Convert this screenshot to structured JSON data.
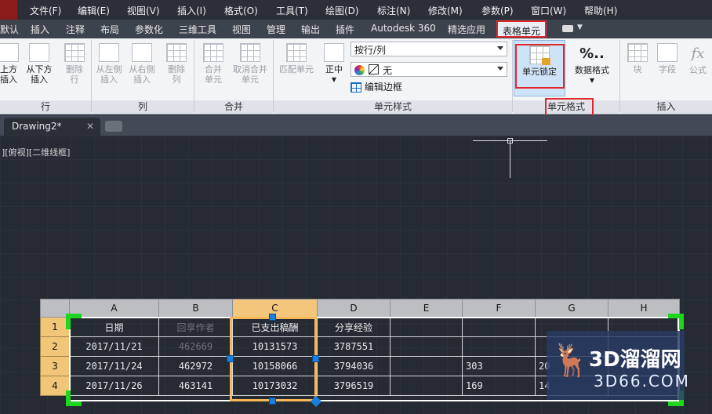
{
  "menu": {
    "items": [
      "文件(F)",
      "编辑(E)",
      "视图(V)",
      "插入(I)",
      "格式(O)",
      "工具(T)",
      "绘图(D)",
      "标注(N)",
      "修改(M)",
      "参数(P)",
      "窗口(W)",
      "帮助(H)"
    ]
  },
  "tabs": {
    "items": [
      "默认",
      "插入",
      "注释",
      "布局",
      "参数化",
      "三维工具",
      "视图",
      "管理",
      "输出",
      "插件",
      "Autodesk 360",
      "精选应用",
      "表格单元"
    ],
    "active": "表格单元"
  },
  "ribbon": {
    "rows": {
      "title": "行",
      "insert_above": "上方\n插入",
      "insert_below": "从下方\n插入",
      "delete_row": "删除\n行"
    },
    "cols": {
      "title": "列",
      "insert_left": "从左侧\n插入",
      "insert_right": "从右侧\n插入",
      "delete_col": "删除\n列"
    },
    "merge": {
      "title": "合并",
      "merge_cells": "合并\n单元",
      "unmerge_cells": "取消合并\n单元"
    },
    "cell_style": {
      "title": "单元样式",
      "match_cell": "匹配单元",
      "align": "正中",
      "style_combo": "按行/列",
      "fill_combo": "无",
      "edit_borders": "编辑边框"
    },
    "cell_format": {
      "title": "单元格式",
      "cell_lock": "单元锁定",
      "data_format": "数据格式",
      "data_format_icon": "%.."
    },
    "insert": {
      "title": "插入",
      "block": "块",
      "field": "字段",
      "formula": "公式"
    }
  },
  "document": {
    "tab_name": "Drawing2*",
    "view_label": "][俯视][二维线框]"
  },
  "table": {
    "columns": [
      "A",
      "B",
      "C",
      "D",
      "E",
      "F",
      "G",
      "H"
    ],
    "selected_column": "C",
    "rows": [
      {
        "num": "1",
        "cells": [
          "日期",
          "回享作者",
          "已支出稿酬",
          "分享经验",
          "",
          "",
          "",
          ""
        ]
      },
      {
        "num": "2",
        "cells": [
          "2017/11/21",
          "462669",
          "10131573",
          "3787551",
          "",
          "",
          "",
          ""
        ]
      },
      {
        "num": "3",
        "cells": [
          "2017/11/24",
          "462972",
          "10158066",
          "3794036",
          "",
          "303",
          "20",
          ""
        ]
      },
      {
        "num": "4",
        "cells": [
          "2017/11/26",
          "463141",
          "10173032",
          "3796519",
          "",
          "169",
          "14",
          ""
        ]
      }
    ]
  },
  "watermark": {
    "name": "3D溜溜网",
    "site": "3D66.COM"
  },
  "colors": {
    "highlight_red": "#e0282e",
    "selection_orange": "#f4b85a",
    "grip_blue": "#1a80e0",
    "corner_green": "#1fd61f"
  }
}
